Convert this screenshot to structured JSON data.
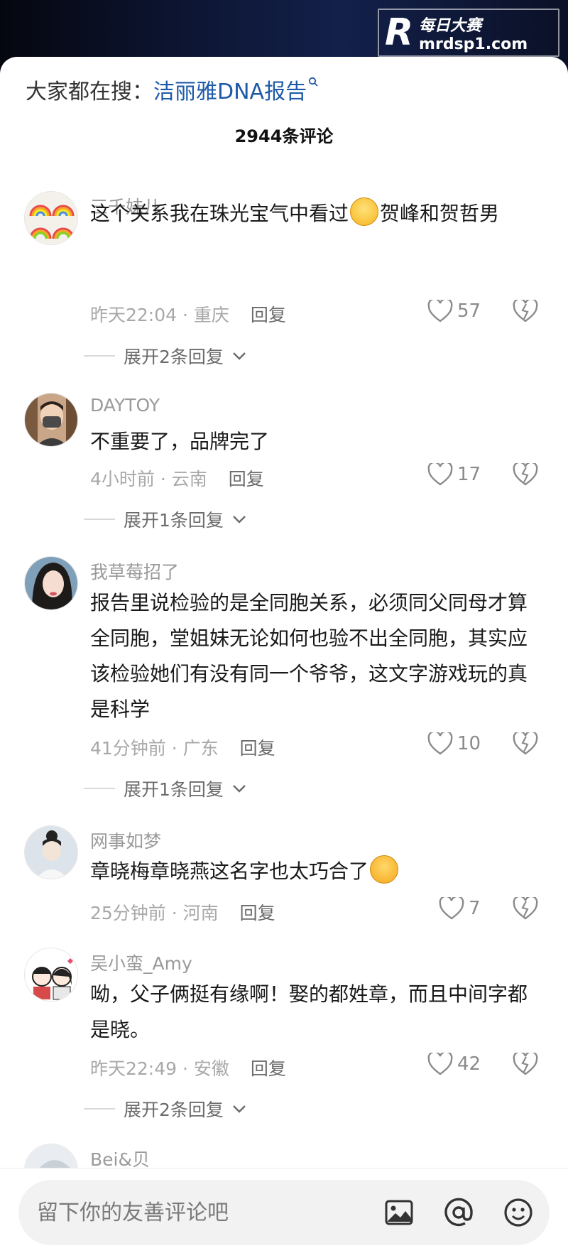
{
  "watermark": {
    "logo": "R",
    "line1": "每日大赛",
    "line2": "mrdsp1.com"
  },
  "search": {
    "prefix": "大家都在搜：",
    "term": "洁丽雅DNA报告"
  },
  "comments_count": "2944条评论",
  "comments": [
    {
      "name": "三千妹儿",
      "text_before": "这个关系我在珠光宝气中看过",
      "emoji": "laugh-emoji",
      "text_after": "贺峰和贺哲男",
      "time": "昨天22:04 · 重庆",
      "reply": "回复",
      "likes": "57",
      "expand": "展开2条回复"
    },
    {
      "name": "DAYTOY",
      "text_before": "不重要了，品牌完了",
      "text_after": "",
      "time": "4小时前 · 云南",
      "reply": "回复",
      "likes": "17",
      "expand": "展开1条回复"
    },
    {
      "name": "我草莓招了",
      "text_before": "报告里说检验的是全同胞关系，必须同父同母才算全同胞，堂姐妹无论如何也验不出全同胞，其实应该检验她们有没有同一个爷爷，这文字游戏玩的真是科学",
      "text_after": "",
      "time": "41分钟前 · 广东",
      "reply": "回复",
      "likes": "10",
      "expand": "展开1条回复"
    },
    {
      "name": "网事如梦",
      "text_before": "章晓梅章晓燕这名字也太巧合了",
      "emoji": "laugh-cry-emoji",
      "text_after": "",
      "time": "25分钟前 · 河南",
      "reply": "回复",
      "likes": "7"
    },
    {
      "name": "吴小蛮_Amy",
      "text_before": "呦，父子俩挺有缘啊！娶的都姓章，而且中间字都是晓。",
      "text_after": "",
      "time": "昨天22:49 · 安徽",
      "reply": "回复",
      "likes": "42",
      "expand": "展开2条回复"
    },
    {
      "name": "Bei&贝"
    }
  ],
  "input": {
    "placeholder": "留下你的友善评论吧"
  },
  "icons": [
    "image-icon",
    "at-icon",
    "emoji-icon",
    "heart-icon",
    "dislike-heart-icon",
    "search-icon",
    "chevron-down-icon"
  ],
  "colors": {
    "link": "#1d5aa8",
    "meta": "#a8a8a8",
    "text": "#1a1a1a"
  }
}
